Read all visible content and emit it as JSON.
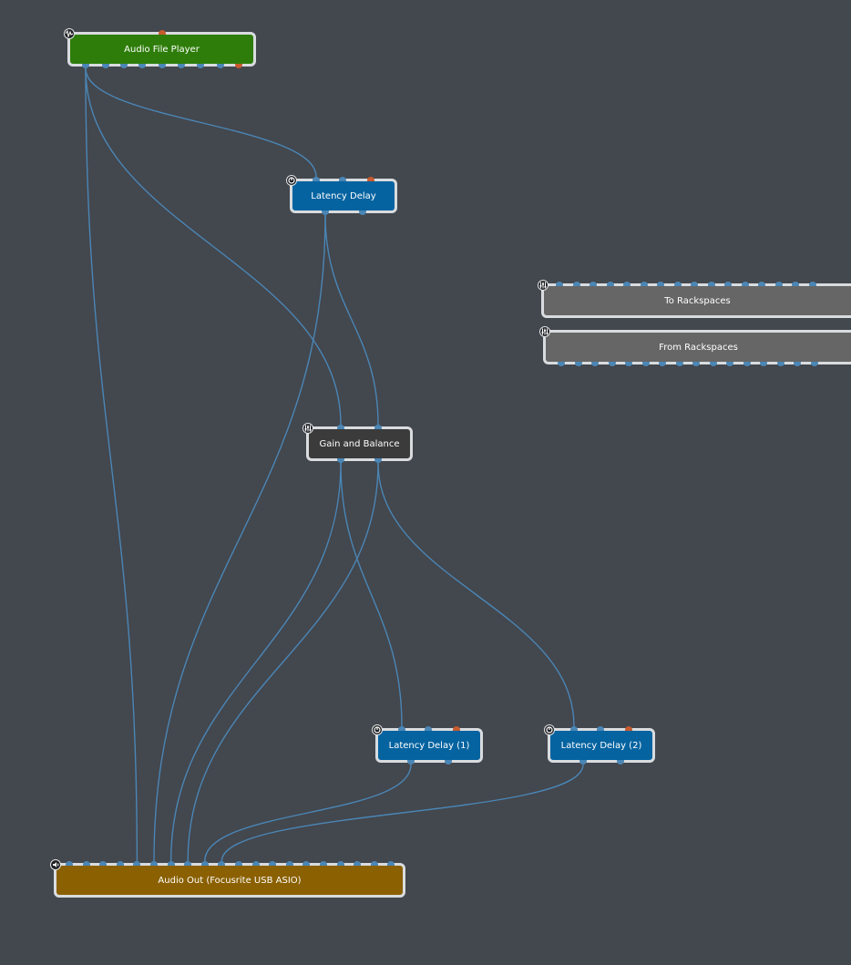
{
  "colors": {
    "background": "#43474e",
    "wire": "#4a86b5",
    "pin_audio": "#4a86b5",
    "pin_midi": "#c65a2e",
    "node_border": "#d9dcdf",
    "player": "#2e7d0a",
    "delay": "#0563a0",
    "gain": "#3b3b3b",
    "rackspace": "#666666",
    "audio_out": "#8a6000"
  },
  "nodes": [
    {
      "id": "player",
      "label": "Audio File Player",
      "style": "player",
      "icon": "waveform-icon",
      "inputs": [],
      "midi_in": true,
      "outputs": 9,
      "midi_out": true
    },
    {
      "id": "delay0",
      "label": "Latency Delay",
      "style": "delay",
      "icon": "plugin-knob-icon",
      "inputs": 2,
      "midi_in": true,
      "outputs": 2,
      "midi_out": false
    },
    {
      "id": "to_rack",
      "label": "To Rackspaces",
      "style": "rackspace",
      "icon": "mixer-sliders-icon",
      "inputs": 16,
      "midi_in": false,
      "outputs": 0,
      "midi_out": false
    },
    {
      "id": "from_rack",
      "label": "From Rackspaces",
      "style": "rackspace",
      "icon": "mixer-sliders-icon",
      "inputs": 0,
      "midi_in": false,
      "outputs": 16,
      "midi_out": false
    },
    {
      "id": "gain",
      "label": "Gain and Balance",
      "style": "gain",
      "icon": "mixer-sliders-icon",
      "inputs": 2,
      "midi_in": false,
      "outputs": 2,
      "midi_out": false
    },
    {
      "id": "delay1",
      "label": "Latency Delay (1)",
      "style": "delay",
      "icon": "plugin-knob-icon",
      "inputs": 2,
      "midi_in": true,
      "outputs": 2,
      "midi_out": false
    },
    {
      "id": "delay2",
      "label": "Latency Delay (2)",
      "style": "delay",
      "icon": "plugin-knob-icon",
      "inputs": 2,
      "midi_in": true,
      "outputs": 2,
      "midi_out": false
    },
    {
      "id": "audio_out",
      "label": "Audio Out (Focusrite USB ASIO)",
      "style": "audio_out",
      "icon": "speaker-output-icon",
      "inputs": 20,
      "midi_in": false,
      "outputs": 0,
      "midi_out": false
    }
  ],
  "connections": [
    {
      "from": "player",
      "out": 0,
      "to": "delay0",
      "in": 0
    },
    {
      "from": "player",
      "out": 0,
      "to": "gain",
      "in": 0
    },
    {
      "from": "player",
      "out": 0,
      "to": "audio_out",
      "in": 4
    },
    {
      "from": "delay0",
      "out": 0,
      "to": "gain",
      "in": 1
    },
    {
      "from": "delay0",
      "out": 0,
      "to": "audio_out",
      "in": 5
    },
    {
      "from": "gain",
      "out": 0,
      "to": "delay1",
      "in": 0
    },
    {
      "from": "gain",
      "out": 0,
      "to": "audio_out",
      "in": 6
    },
    {
      "from": "gain",
      "out": 1,
      "to": "delay2",
      "in": 0
    },
    {
      "from": "gain",
      "out": 1,
      "to": "audio_out",
      "in": 7
    },
    {
      "from": "delay1",
      "out": 0,
      "to": "audio_out",
      "in": 8
    },
    {
      "from": "delay2",
      "out": 0,
      "to": "audio_out",
      "in": 9
    }
  ]
}
